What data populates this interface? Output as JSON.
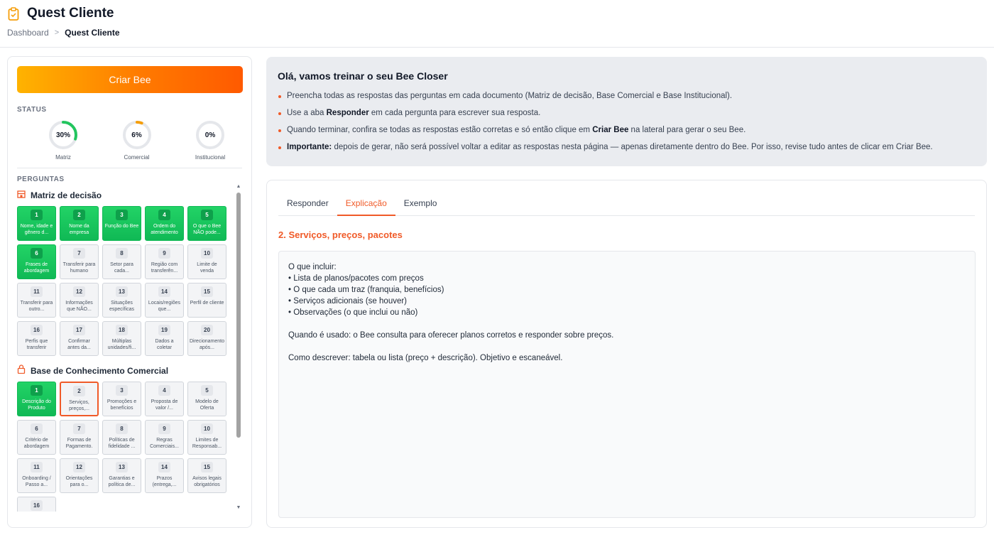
{
  "header": {
    "title": "Quest Cliente",
    "breadcrumb": {
      "home": "Dashboard",
      "current": "Quest Cliente"
    }
  },
  "sidebar": {
    "create_label": "Criar Bee",
    "status_label": "STATUS",
    "status": [
      {
        "name": "Matriz",
        "value_text": "30%",
        "progress": 0.3
      },
      {
        "name": "Comercial",
        "value_text": "6%",
        "progress": 0.06
      },
      {
        "name": "Institucional",
        "value_text": "0%",
        "progress": 0.0
      }
    ],
    "questions_label": "PERGUNTAS",
    "groups": [
      {
        "title": "Matriz de decisão",
        "icon": "building-icon",
        "items": [
          {
            "num": "1",
            "label": "Nome, idade e gênero d...",
            "state": "done"
          },
          {
            "num": "2",
            "label": "Nome da empresa",
            "state": "done"
          },
          {
            "num": "3",
            "label": "Função do Bee",
            "state": "done"
          },
          {
            "num": "4",
            "label": "Ordem do atendimento",
            "state": "done"
          },
          {
            "num": "5",
            "label": "O que o Bee NÃO pode...",
            "state": "done"
          },
          {
            "num": "6",
            "label": "Frases de abordagem",
            "state": "done"
          },
          {
            "num": "7",
            "label": "Transferir para humano",
            "state": "todo"
          },
          {
            "num": "8",
            "label": "Setor para cada...",
            "state": "todo"
          },
          {
            "num": "9",
            "label": "Região com transferên...",
            "state": "todo"
          },
          {
            "num": "10",
            "label": "Limite de venda",
            "state": "todo"
          },
          {
            "num": "11",
            "label": "Transferir para outro...",
            "state": "todo"
          },
          {
            "num": "12",
            "label": "Informações que NÃO...",
            "state": "todo"
          },
          {
            "num": "13",
            "label": "Situações específicas",
            "state": "todo"
          },
          {
            "num": "14",
            "label": "Locais/regiões que...",
            "state": "todo"
          },
          {
            "num": "15",
            "label": "Perfil de cliente",
            "state": "todo"
          },
          {
            "num": "16",
            "label": "Perfis que transferir",
            "state": "todo"
          },
          {
            "num": "17",
            "label": "Confirmar antes da...",
            "state": "todo"
          },
          {
            "num": "18",
            "label": "Múltiplas unidades/fi...",
            "state": "todo"
          },
          {
            "num": "19",
            "label": "Dados a coletar",
            "state": "todo"
          },
          {
            "num": "20",
            "label": "Direcionamento após...",
            "state": "todo"
          }
        ]
      },
      {
        "title": "Base de Conhecimento Comercial",
        "icon": "lock-icon",
        "items": [
          {
            "num": "1",
            "label": "Descrição do Produto",
            "state": "done"
          },
          {
            "num": "2",
            "label": "Serviços, preços,...",
            "state": "active"
          },
          {
            "num": "3",
            "label": "Promoções e benefícios",
            "state": "todo"
          },
          {
            "num": "4",
            "label": "Proposta de valor /...",
            "state": "todo"
          },
          {
            "num": "5",
            "label": "Modelo de Oferta",
            "state": "todo"
          },
          {
            "num": "6",
            "label": "Critério de abordagem",
            "state": "todo"
          },
          {
            "num": "7",
            "label": "Formas de Pagamento.",
            "state": "todo"
          },
          {
            "num": "8",
            "label": "Políticas de fidelidade ...",
            "state": "todo"
          },
          {
            "num": "9",
            "label": "Regras Comerciais...",
            "state": "todo"
          },
          {
            "num": "10",
            "label": "Limites de Responsab...",
            "state": "todo"
          },
          {
            "num": "11",
            "label": "Onboarding / Passo a...",
            "state": "todo"
          },
          {
            "num": "12",
            "label": "Orientações para o...",
            "state": "todo"
          },
          {
            "num": "13",
            "label": "Garantias e política de...",
            "state": "todo"
          },
          {
            "num": "14",
            "label": "Prazos (entrega,...",
            "state": "todo"
          },
          {
            "num": "15",
            "label": "Avisos legais obrigatórios",
            "state": "todo"
          },
          {
            "num": "16",
            "label": "",
            "state": "todo"
          }
        ]
      }
    ]
  },
  "info": {
    "title": "Olá, vamos treinar o seu Bee Closer",
    "items": [
      {
        "pre": "Preencha todas as respostas das perguntas em cada documento (Matriz de decisão, Base Comercial e Base Institucional).",
        "bold": "",
        "post": ""
      },
      {
        "pre": "Use a aba ",
        "bold": "Responder",
        "post": " em cada pergunta para escrever sua resposta."
      },
      {
        "pre": "Quando terminar, confira se todas as respostas estão corretas e só então clique em ",
        "bold": "Criar Bee",
        "post": " na lateral para gerar o seu Bee."
      },
      {
        "pre": "",
        "bold": "Importante:",
        "post": " depois de gerar, não será possível voltar a editar as respostas nesta página — apenas diretamente dentro do Bee. Por isso, revise tudo antes de clicar em Criar Bee."
      }
    ]
  },
  "content": {
    "tabs": [
      {
        "label": "Responder",
        "active": false
      },
      {
        "label": "Explicação",
        "active": true
      },
      {
        "label": "Exemplo",
        "active": false
      }
    ],
    "section_title": "2. Serviços, preços, pacotes",
    "explanation": "O que incluir:\n• Lista de planos/pacotes com preços\n• O que cada um traz (franquia, benefícios)\n• Serviços adicionais (se houver)\n• Observações (o que inclui ou não)\n\nQuando é usado: o Bee consulta para oferecer planos corretos e responder sobre preços.\n\nComo descrever: tabela ou lista (preço + descrição). Objetivo e escaneável."
  },
  "colors": {
    "accent": "#f05a28",
    "done": "#16c75e",
    "ring_track": "#e5e7eb",
    "ring_matriz": "#22c55e",
    "ring_comercial": "#f59e0b"
  }
}
